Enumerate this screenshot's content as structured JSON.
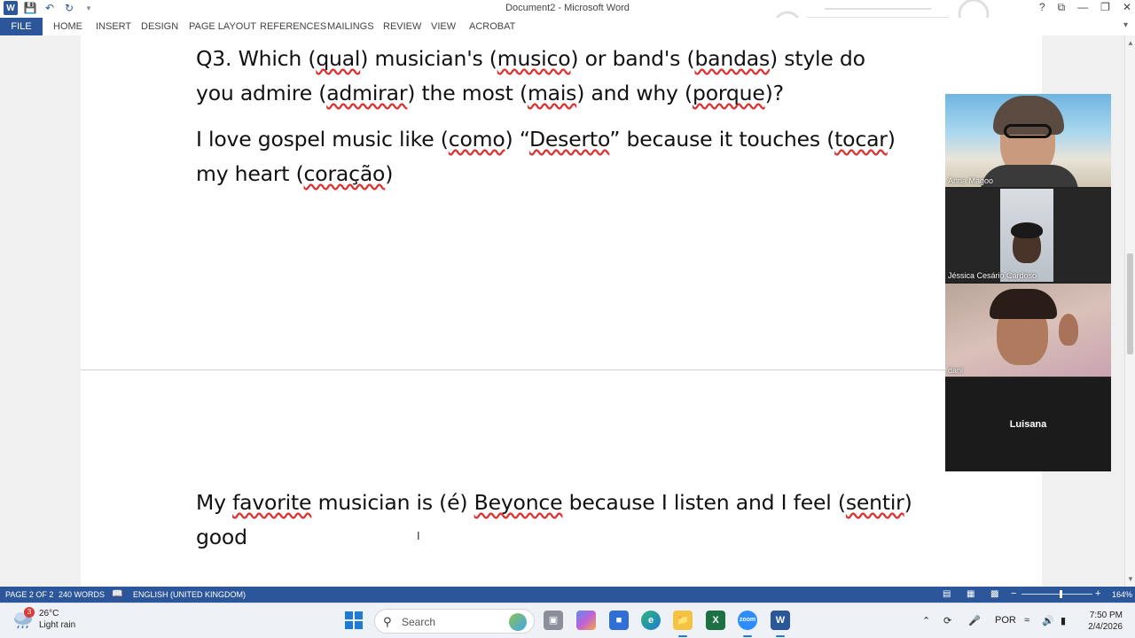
{
  "window": {
    "title": "Document2 - Microsoft Word",
    "qat": [
      "word-icon",
      "save-icon",
      "undo-icon",
      "redo-icon",
      "customize-icon"
    ],
    "controls": [
      "?",
      "⧉",
      "─",
      "❐",
      "✕"
    ]
  },
  "ribbon": {
    "file": "FILE",
    "tabs": [
      "HOME",
      "INSERT",
      "DESIGN",
      "PAGE LAYOUT",
      "REFERENCES",
      "MAILINGS",
      "REVIEW",
      "VIEW",
      "ACROBAT"
    ]
  },
  "document": {
    "q3_line1_a": "Q3.   Which (",
    "q3_line1_qual": "qual",
    "q3_line1_b": ") musician's (",
    "q3_line1_musico": "musico",
    "q3_line1_c": ") or band's (",
    "q3_line1_bandas": "bandas",
    "q3_line1_d": ") style do",
    "q3_line2_a": "you admire (",
    "q3_line2_admirar": "admirar",
    "q3_line2_b": ") the most (",
    "q3_line2_mais": "mais",
    "q3_line2_c": ") and why (",
    "q3_line2_porque": "porque",
    "q3_line2_d": ")?",
    "ans1_line1_a": "I love gospel music like (",
    "ans1_line1_como": "como",
    "ans1_line1_b": ") “",
    "ans1_line1_deserto": "Deserto",
    "ans1_line1_c": "” because it touches (",
    "ans1_line1_tocar": "tocar",
    "ans1_line1_d": ")",
    "ans1_line2_a": "my heart (",
    "ans1_line2_coracao": "coração",
    "ans1_line2_b": ")",
    "ans2_line1_a": "My ",
    "ans2_line1_favorite": "favorite",
    "ans2_line1_b": " musician is (é) ",
    "ans2_line1_beyonce": "Beyonce",
    "ans2_line1_c": " because I listen and I feel (",
    "ans2_line1_sentir": "sentir",
    "ans2_line1_d": ")",
    "ans2_line2": "good",
    "caret": "I"
  },
  "video": {
    "participants": [
      {
        "name": "Anna Magoo"
      },
      {
        "name": "Jéssica Cesário Cardoso"
      },
      {
        "name": "dani"
      },
      {
        "name": "Luisana"
      }
    ]
  },
  "status": {
    "page": "PAGE 2 OF 2",
    "words": "240 WORDS",
    "language": "ENGLISH (UNITED KINGDOM)",
    "zoom": "164%"
  },
  "taskbar": {
    "weather_temp": "26°C",
    "weather_desc": "Light rain",
    "weather_badge": "3",
    "search_placeholder": "Search",
    "lang": "POR",
    "time": "7:50 PM",
    "date": "2/4/2026"
  }
}
